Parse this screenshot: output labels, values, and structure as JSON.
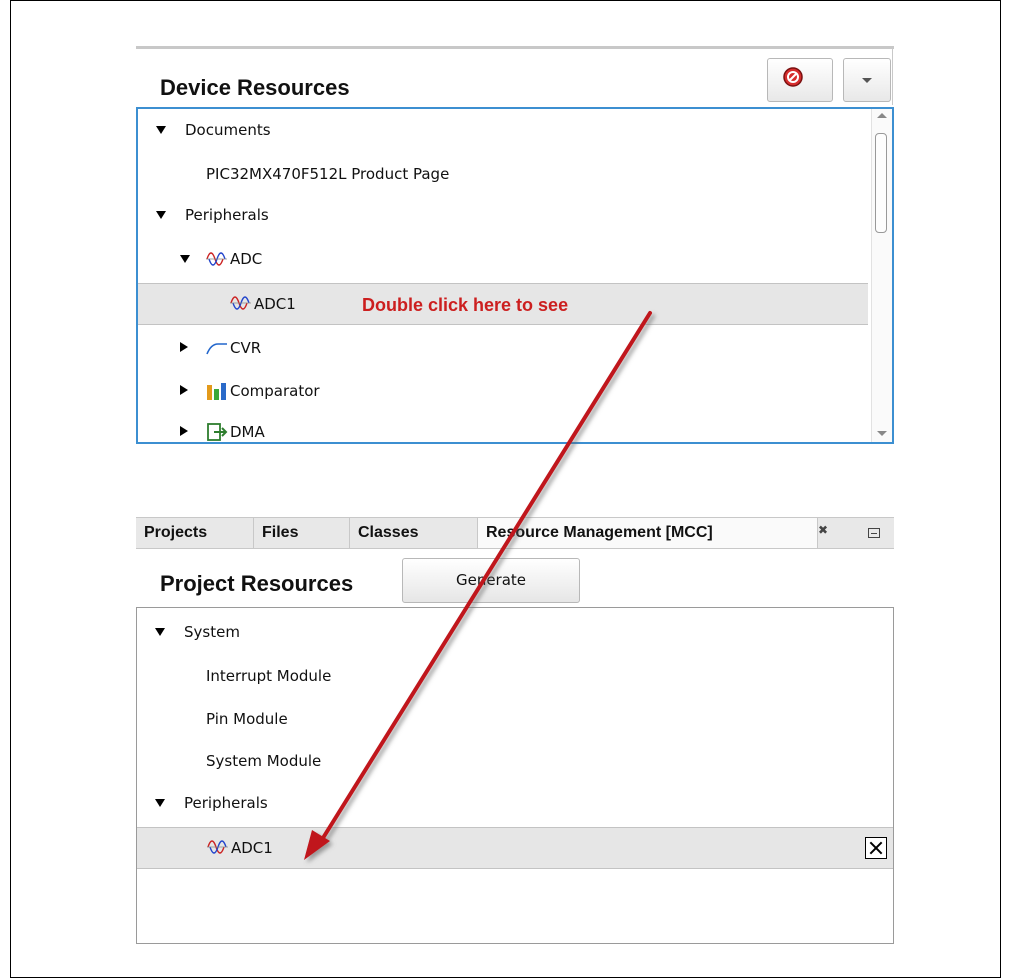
{
  "device_resources": {
    "title": "Device Resources",
    "tree": {
      "documents": {
        "label": "Documents"
      },
      "product_page": {
        "label": "PIC32MX470F512L Product Page"
      },
      "peripherals": {
        "label": "Peripherals"
      },
      "adc": {
        "label": "ADC"
      },
      "adc1": {
        "label": "ADC1"
      },
      "cvr": {
        "label": "CVR"
      },
      "comparator": {
        "label": "Comparator"
      },
      "dma": {
        "label": "DMA"
      }
    },
    "annotation": "Double click here to see"
  },
  "tabs": [
    {
      "label": "Projects"
    },
    {
      "label": "Files"
    },
    {
      "label": "Classes"
    },
    {
      "label": "Resource Management [MCC]"
    }
  ],
  "tab_close_glyph": "✖",
  "project_resources": {
    "title": "Project Resources",
    "generate_label": "Generate",
    "tree": {
      "system": {
        "label": "System"
      },
      "interrupt_module": {
        "label": "Interrupt Module"
      },
      "pin_module": {
        "label": "Pin Module"
      },
      "system_module": {
        "label": "System Module"
      },
      "peripherals": {
        "label": "Peripherals"
      },
      "adc1": {
        "label": "ADC1"
      }
    }
  },
  "colors": {
    "annotation_red": "#cc1f1f",
    "arrow_red": "#c0141a",
    "tree_focus_border": "#3c8fd1",
    "selected_row": "#e6e6e6"
  },
  "icons": {
    "stop": "stop-icon",
    "dropdown": "dropdown-arrow-icon",
    "adc": "waveform-icon",
    "cvr": "curve-icon",
    "comparator": "bar-chart-icon",
    "dma": "dma-icon",
    "remove": "close-box-icon"
  }
}
